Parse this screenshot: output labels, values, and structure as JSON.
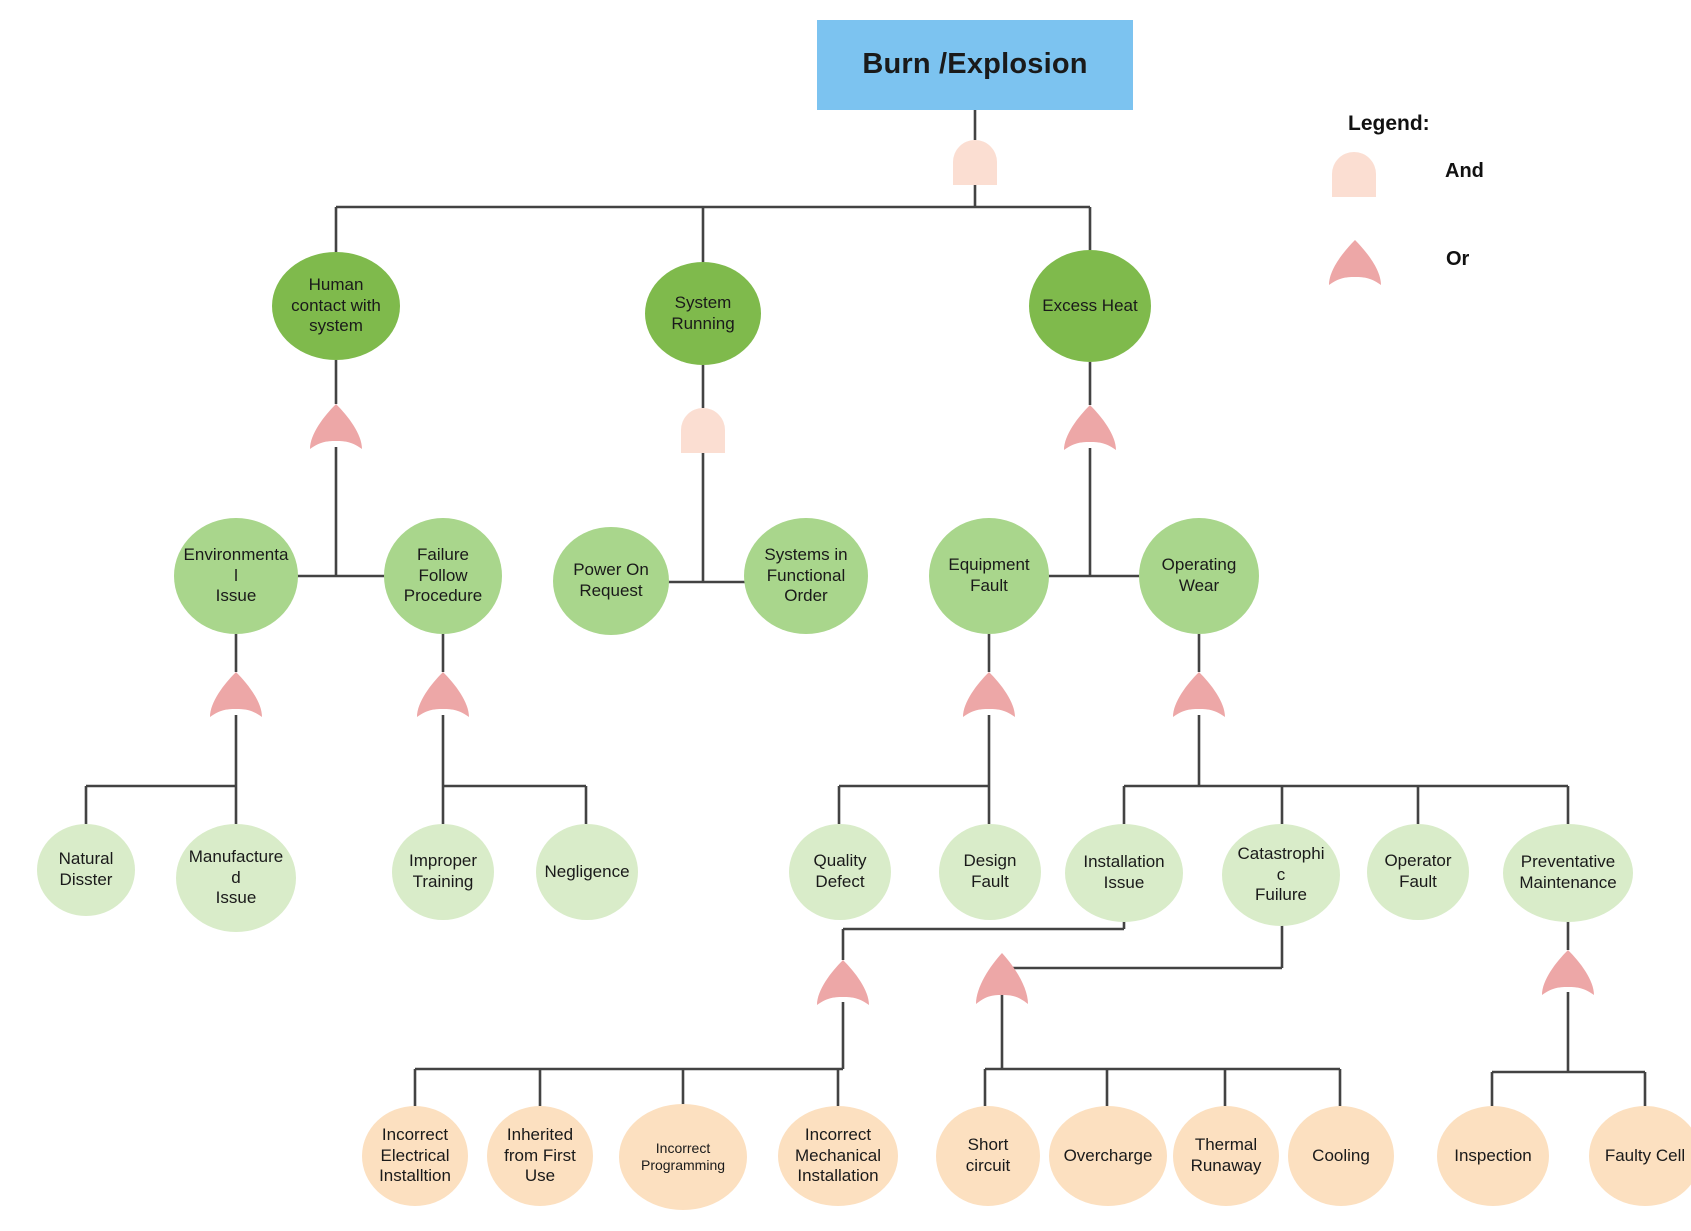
{
  "diagram": {
    "title": "Burn /Explosion",
    "type": "fault-tree"
  },
  "legend": {
    "title": "Legend:",
    "and_label": "And",
    "or_label": "Or"
  },
  "colors": {
    "top_event": "#7CC3F0",
    "level2": "#7FBA4C",
    "level3": "#A9D68C",
    "level4": "#D9ECC9",
    "leaf": "#FCE0C0",
    "and_gate": "#FBDED2",
    "or_gate": "#EDA7A7",
    "wire": "#434343"
  },
  "nodes": {
    "top": {
      "label": "Burn /Explosion"
    },
    "level2": [
      {
        "label": "Human\ncontact with\nsystem"
      },
      {
        "label": "System\nRunning"
      },
      {
        "label": "Excess Heat"
      }
    ],
    "level3": [
      {
        "label": "Environmenta\nl\nIssue"
      },
      {
        "label": "Failure\nFollow\nProcedure"
      },
      {
        "label": "Power On\nRequest"
      },
      {
        "label": "Systems in\nFunctional\nOrder"
      },
      {
        "label": "Equipment\nFault"
      },
      {
        "label": "Operating\nWear"
      }
    ],
    "level4": [
      {
        "label": "Natural\nDisster"
      },
      {
        "label": "Manufacture\nd\nIssue"
      },
      {
        "label": "Improper\nTraining"
      },
      {
        "label": "Negligence"
      },
      {
        "label": "Quality\nDefect"
      },
      {
        "label": "Design\nFault"
      },
      {
        "label": "Installation\nIssue"
      },
      {
        "label": "Catastrophi\nc\nFuilure"
      },
      {
        "label": "Operator\nFault"
      },
      {
        "label": "Preventative\nMaintenance"
      }
    ],
    "leaves": [
      {
        "label": "Incorrect\nElectrical\nInstalltion"
      },
      {
        "label": "Inherited\nfrom First\nUse"
      },
      {
        "label": "Incorrect\nProgramming"
      },
      {
        "label": "Incorrect\nMechanical\nInstallation"
      },
      {
        "label": "Short\ncircuit"
      },
      {
        "label": "Overcharge"
      },
      {
        "label": "Thermal\nRunaway"
      },
      {
        "label": "Cooling"
      },
      {
        "label": "Inspection"
      },
      {
        "label": "Faulty Cell"
      }
    ]
  },
  "gates": [
    {
      "name": "gate-top",
      "type": "and"
    },
    {
      "name": "gate-human-contact",
      "type": "or"
    },
    {
      "name": "gate-system-running",
      "type": "and"
    },
    {
      "name": "gate-excess-heat",
      "type": "or"
    },
    {
      "name": "gate-environmental-issue",
      "type": "or"
    },
    {
      "name": "gate-failure-follow-procedure",
      "type": "or"
    },
    {
      "name": "gate-equipment-fault",
      "type": "or"
    },
    {
      "name": "gate-operating-wear",
      "type": "or"
    },
    {
      "name": "gate-installation-issue",
      "type": "or"
    },
    {
      "name": "gate-catastrophic-failure",
      "type": "or"
    },
    {
      "name": "gate-preventative-maintenance",
      "type": "or"
    }
  ]
}
